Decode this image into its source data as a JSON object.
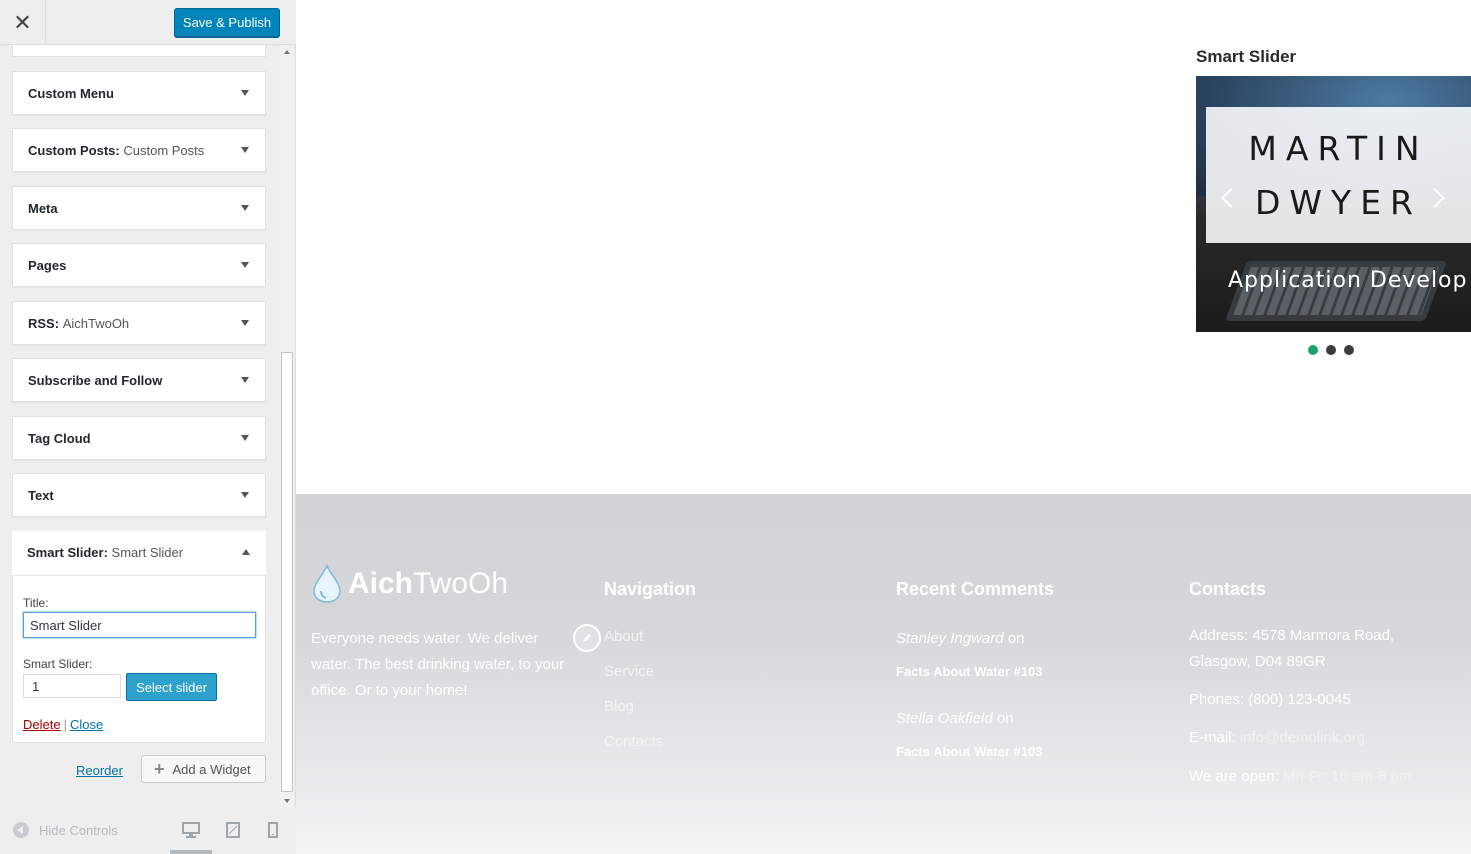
{
  "header": {
    "close_glyph": "✕",
    "publish_label": "Save & Publish"
  },
  "widgets": [
    {
      "title": "Custom Menu",
      "sub": ""
    },
    {
      "title": "Custom Posts:",
      "sub": "Custom Posts"
    },
    {
      "title": "Meta",
      "sub": ""
    },
    {
      "title": "Pages",
      "sub": ""
    },
    {
      "title": "RSS:",
      "sub": "AichTwoOh"
    },
    {
      "title": "Subscribe and Follow",
      "sub": ""
    },
    {
      "title": "Tag Cloud",
      "sub": ""
    },
    {
      "title": "Text",
      "sub": ""
    }
  ],
  "expanded_widget": {
    "title": "Smart Slider:",
    "sub": "Smart Slider",
    "title_label": "Title:",
    "title_value": "Smart Slider",
    "slider_label": "Smart Slider:",
    "slider_value": "1",
    "select_label": "Select slider",
    "delete_label": "Delete",
    "separator": "|",
    "close_label": "Close"
  },
  "actions": {
    "reorder_label": "Reorder",
    "add_widget_label": "Add a Widget",
    "add_glyph": "+"
  },
  "footer_controls": {
    "hide_label": "Hide Controls",
    "devices": [
      "desktop-icon",
      "tablet-icon",
      "mobile-icon"
    ]
  },
  "preview": {
    "widget_heading": "Smart Slider",
    "slide": {
      "line1": "MARTIN",
      "line2": "DWYER",
      "caption": "Application Develop"
    },
    "dots": {
      "count": 3,
      "active_index": 0
    },
    "colors": {
      "accent_dot": "#1aa36b",
      "publish_blue": "#0085ba"
    }
  },
  "site_footer": {
    "logo_bold": "Aich",
    "logo_light": "TwoOh",
    "about": "Everyone needs water. We deliver water. The best drinking water, to your office. Or to your home!",
    "navigation": {
      "heading": "Navigation",
      "links": [
        "About",
        "Service",
        "Blog",
        "Contacts"
      ]
    },
    "recent_comments": {
      "heading": "Recent Comments",
      "items": [
        {
          "author": "Stanley Ingward",
          "on": " on",
          "post": "Facts About Water #103"
        },
        {
          "author": "Stella Oakfield",
          "on": " on",
          "post": "Facts About Water #103"
        }
      ]
    },
    "contacts": {
      "heading": "Contacts",
      "address": "Address: 4578 Marmora Road, Glasgow, D04 89GR",
      "phones": "Phones: (800) 123-0045",
      "email_label": "E-mail: ",
      "email": "info@demolink.org",
      "hours_label": "We are open: ",
      "hours": "Mn-Fr: 10 am-8 pm"
    }
  }
}
